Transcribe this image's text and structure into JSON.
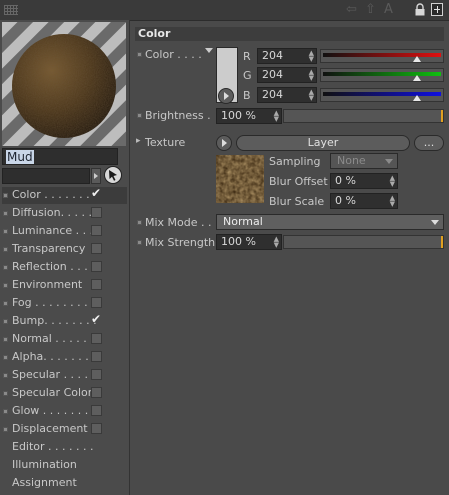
{
  "topbar": {
    "faint_icons": "⇦ ⇧ A"
  },
  "material": {
    "name": "Mud"
  },
  "channels": [
    {
      "label": "Color . . . . . . .",
      "checked": true,
      "selected": true
    },
    {
      "label": "Diffusion. . . . .",
      "checked": false
    },
    {
      "label": "Luminance . . . .",
      "checked": false
    },
    {
      "label": "Transparency",
      "checked": false
    },
    {
      "label": "Reflection . . . .",
      "checked": false
    },
    {
      "label": "Environment",
      "checked": false
    },
    {
      "label": "Fog . . . . . . . . .",
      "checked": false
    },
    {
      "label": "Bump. . . . . . . .",
      "checked": true
    },
    {
      "label": "Normal . . . . . .",
      "checked": false
    },
    {
      "label": "Alpha. . . . . . . .",
      "checked": false
    },
    {
      "label": "Specular . . . . .",
      "checked": false
    },
    {
      "label": "Specular Color",
      "checked": false
    },
    {
      "label": "Glow . . . . . . . .",
      "checked": false
    },
    {
      "label": "Displacement",
      "checked": false
    },
    {
      "label": "Editor . . . . . . .",
      "checkbox": false
    },
    {
      "label": "Illumination",
      "checkbox": false
    },
    {
      "label": "Assignment",
      "checkbox": false
    }
  ],
  "panel": {
    "title": "Color",
    "color_label": "Color . . . .",
    "swatch_color": "#cccccc",
    "r_label": "R",
    "r_value": "204",
    "r_level": 0.8,
    "g_label": "G",
    "g_value": "204",
    "g_level": 0.8,
    "b_label": "B",
    "b_value": "204",
    "b_level": 0.8,
    "brightness_label": "Brightness .",
    "brightness_value": "100 %",
    "texture_label": "Texture",
    "texture_button": "Layer",
    "texture_more": "...",
    "sampling_label": "Sampling",
    "sampling_value": "None",
    "blur_offset_label": "Blur Offset",
    "blur_offset_value": "0 %",
    "blur_scale_label": "Blur Scale",
    "blur_scale_value": "0 %",
    "mix_mode_label": "Mix Mode . .",
    "mix_mode_value": "Normal",
    "mix_strength_label": "Mix Strength",
    "mix_strength_value": "100 %"
  },
  "colors": {
    "red": "#e01010",
    "green": "#10c010",
    "blue": "#1010e0",
    "accent": "#e0a020"
  }
}
